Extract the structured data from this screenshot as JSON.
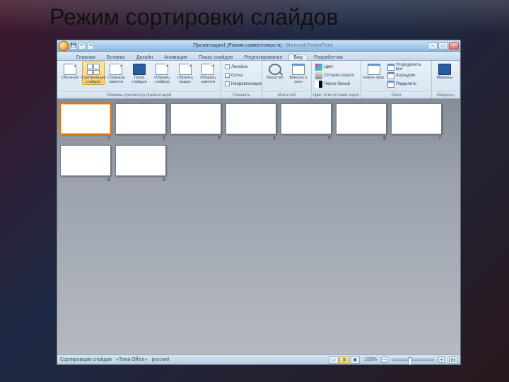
{
  "page_title": "Режим сортировки слайдов",
  "titlebar": {
    "doc": "Презентация1",
    "mode": "[Режим совместимости]",
    "app": "Microsoft PowerPoint"
  },
  "qat": {
    "save": "💾",
    "undo": "↶",
    "redo": "↷"
  },
  "win": {
    "min": "–",
    "max": "▭",
    "close": "×"
  },
  "tabs": {
    "home": "Главная",
    "insert": "Вставка",
    "design": "Дизайн",
    "anim": "Анимация",
    "show": "Показ слайдов",
    "review": "Рецензирование",
    "view": "Вид",
    "developer": "Разработчик"
  },
  "ribbon": {
    "group_views": {
      "label": "Режимы просмотра презентации",
      "normal": "Обычный",
      "sorter": "Сортировщик слайдов",
      "notes": "Страница заметок",
      "show": "Показ слайдов",
      "master_slide": "Образец слайдов",
      "master_handout": "Образец выдач",
      "master_notes": "Образец заметок"
    },
    "group_show": {
      "label": "Показать",
      "ruler": "Линейка",
      "gridlines": "Сетка",
      "guides": "Направляющие"
    },
    "group_zoom": {
      "label": "Масштаб",
      "zoom": "Масштаб",
      "fit": "Вписать в окно"
    },
    "group_color": {
      "label": "Цвет или оттенки серого",
      "color": "Цвет",
      "gray": "Оттенки серого",
      "bw": "Черно-белый"
    },
    "group_window": {
      "label": "Окно",
      "new": "Новое окно",
      "arrange": "Упорядочить все",
      "cascade": "Каскадом",
      "split": "Разделить"
    },
    "group_macros": {
      "label": "Макросы",
      "macros": "Макросы"
    }
  },
  "slides": [
    {
      "num": "1",
      "selected": true
    },
    {
      "num": "2",
      "selected": false
    },
    {
      "num": "3",
      "selected": false
    },
    {
      "num": "4",
      "selected": false
    },
    {
      "num": "5",
      "selected": false
    },
    {
      "num": "6",
      "selected": false
    },
    {
      "num": "7",
      "selected": false
    },
    {
      "num": "8",
      "selected": false
    },
    {
      "num": "9",
      "selected": false
    }
  ],
  "status": {
    "mode": "Сортировщик слайдов",
    "theme_label": "Тема Office",
    "lang": "русский",
    "zoom": "100%"
  }
}
